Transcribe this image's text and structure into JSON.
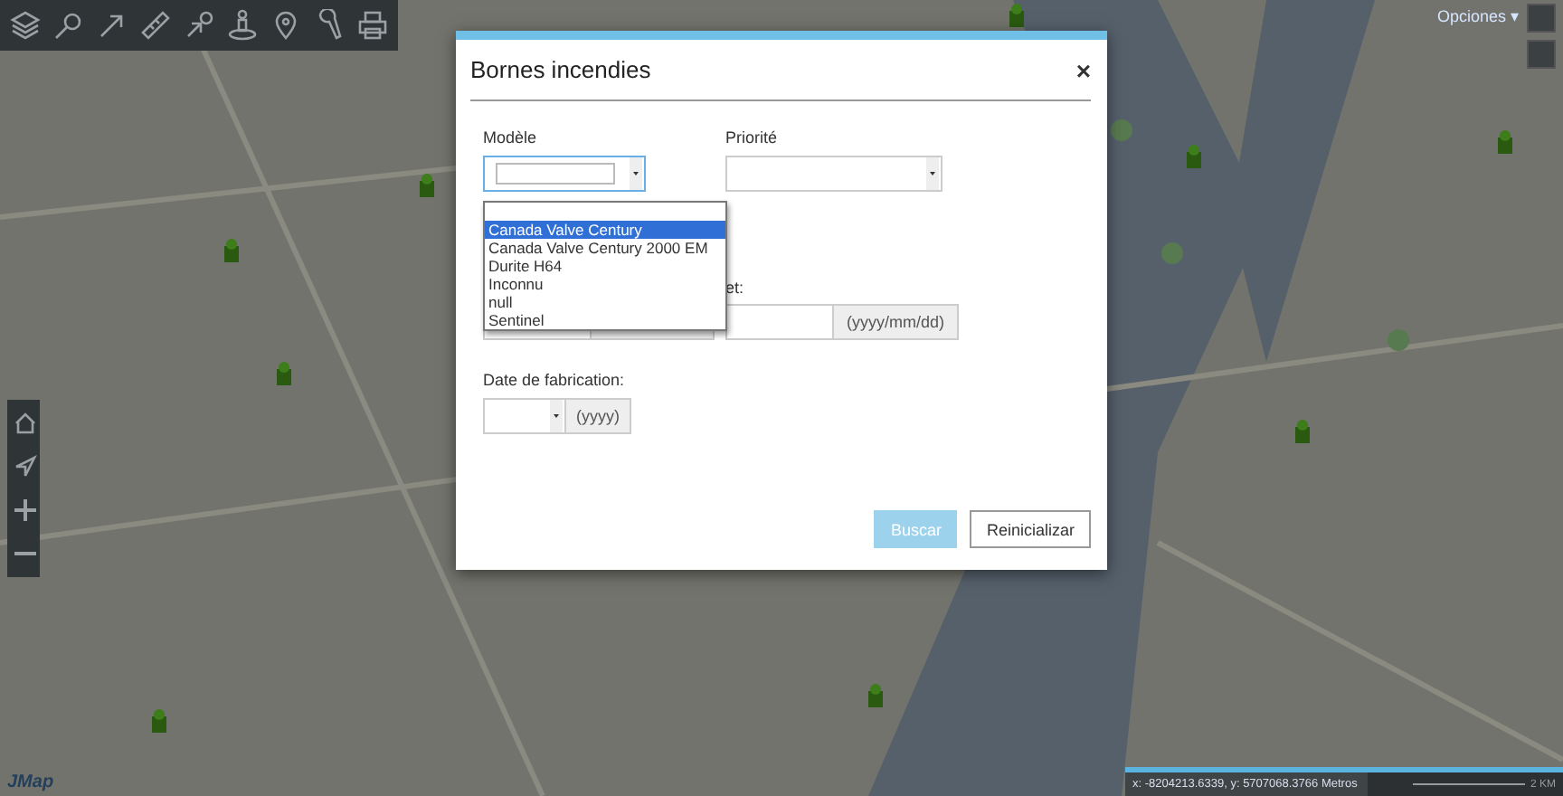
{
  "options_menu": {
    "label": "Opciones ▾"
  },
  "dialog": {
    "title": "Bornes incendies",
    "close": "×",
    "model": {
      "label": "Modèle",
      "options": [
        {
          "label": "Canada Valve Century",
          "selected": true
        },
        {
          "label": "Canada Valve Century 2000 EM",
          "selected": false
        },
        {
          "label": "Durite H64",
          "selected": false
        },
        {
          "label": "Inconnu",
          "selected": false
        },
        {
          "label": "null",
          "selected": false
        },
        {
          "label": "Sentinel",
          "selected": false
        }
      ]
    },
    "priority": {
      "label": "Priorité"
    },
    "date_range": {
      "label": "et:",
      "suffix": "(yyyy/mm/dd)"
    },
    "fabrication": {
      "label": "Date de fabrication:",
      "suffix": "(yyyy)"
    },
    "buttons": [
      {
        "label": "Buscar",
        "disabled": true
      },
      {
        "label": "Reinicializar",
        "disabled": false
      }
    ]
  },
  "logo": "JMap",
  "coordinates": "x: -8204213.6339, y: 5707068.3766 Metros",
  "scale": "2 KM"
}
